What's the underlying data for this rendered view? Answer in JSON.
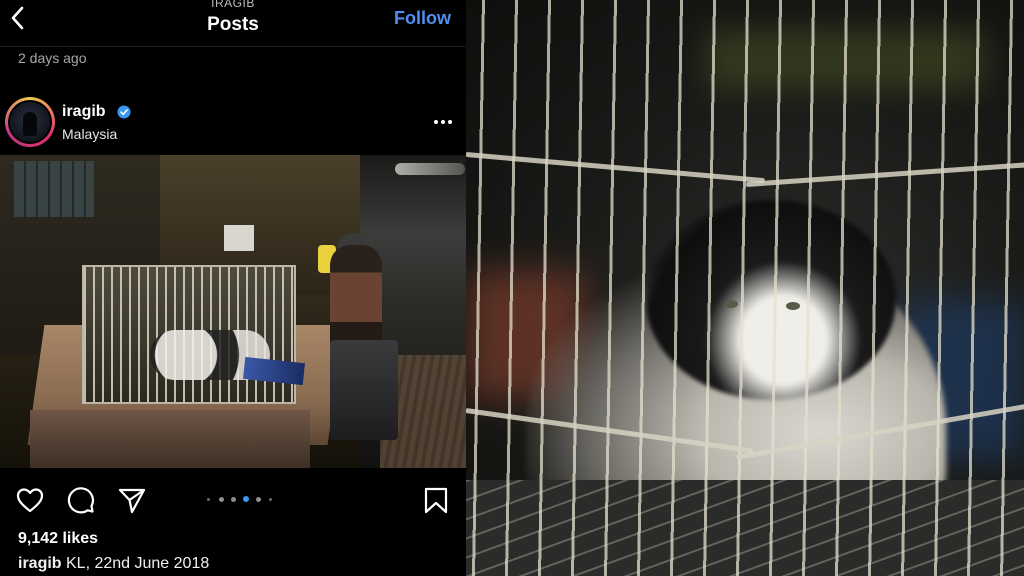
{
  "header": {
    "username_small": "IRAGIB",
    "title": "Posts",
    "follow_label": "Follow"
  },
  "post": {
    "time_ago": "2 days ago",
    "username": "iragib",
    "location": "Malaysia",
    "likes": "9,142 likes",
    "caption_user": "iragib",
    "caption_text": " KL, 22nd June 2018",
    "carousel": {
      "count": 6,
      "active_index": 3
    }
  },
  "icons": {
    "back": "chevron-left-icon",
    "verified": "verified-badge-icon",
    "more": "more-horizontal-icon",
    "like": "heart-icon",
    "comment": "comment-icon",
    "share": "send-icon",
    "save": "bookmark-icon"
  },
  "colors": {
    "accent": "#4f8ff0",
    "background": "#000000",
    "carousel_active": "#3897f0"
  }
}
